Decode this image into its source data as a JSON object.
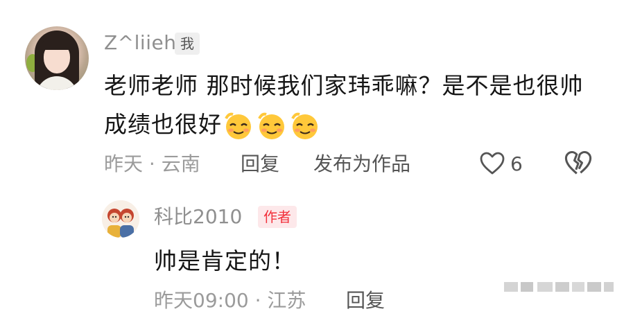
{
  "comment": {
    "username": "Z^liieh",
    "badge": "我",
    "text": "老师老师 那时候我们家玮乖嘛？是不是也很帅 成绩也很好",
    "emojis": [
      "smile-emoji",
      "smile-emoji",
      "smile-emoji"
    ],
    "time_location": "昨天 · 云南",
    "reply_label": "回复",
    "publish_label": "发布为作品",
    "like_count": "6",
    "icons": {
      "like": "heart-outline-icon",
      "dislike": "broken-heart-icon"
    }
  },
  "reply": {
    "username": "科比2010",
    "badge": "作者",
    "text": "帅是肯定的！",
    "time_location": "昨天09:00 · 江苏",
    "reply_label": "回复"
  },
  "colors": {
    "meta_text": "#9b9b9b",
    "body_text": "#161616",
    "author_badge_bg": "#fde8ea",
    "author_badge_text": "#f2303b",
    "emoji_yellow": "#ffc83a"
  }
}
